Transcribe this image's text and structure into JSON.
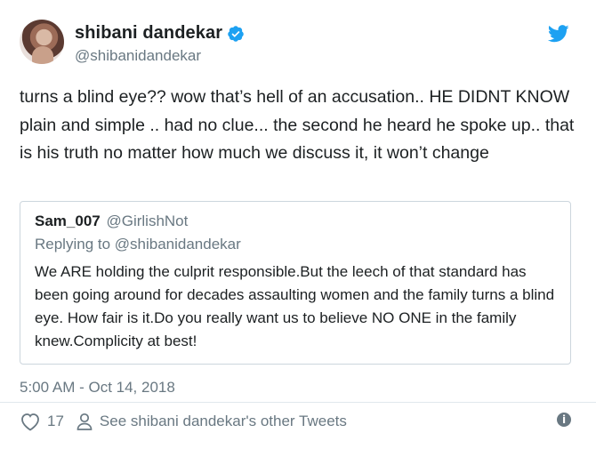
{
  "author": {
    "display_name": "shibani dandekar",
    "handle": "@shibanidandekar",
    "verified": true
  },
  "tweet": {
    "text": "turns a blind eye?? wow that’s hell of an accusation.. HE DIDNT KNOW plain and simple .. had no clue... the second he heard he spoke up.. that is his truth no matter how much we discuss it, it won’t change",
    "timestamp": "5:00 AM - Oct 14, 2018"
  },
  "quoted_tweet": {
    "display_name": "Sam_007",
    "handle": "@GirlishNot",
    "reply_context": "Replying to @shibanidandekar",
    "text": "We ARE holding the culprit responsible.But the leech of that standard has been going around for decades assaulting women and the family turns a blind eye. How fair is it.Do you really want us to believe NO ONE in the family knew.Complicity at best!"
  },
  "actions": {
    "like_count": "17",
    "other_tweets_label": "See shibani dandekar's other Tweets",
    "info_symbol": "i"
  },
  "colors": {
    "twitter_blue": "#1da1f2",
    "text_primary": "#1c2022",
    "text_secondary": "#697882",
    "border": "#ccd6dd"
  }
}
